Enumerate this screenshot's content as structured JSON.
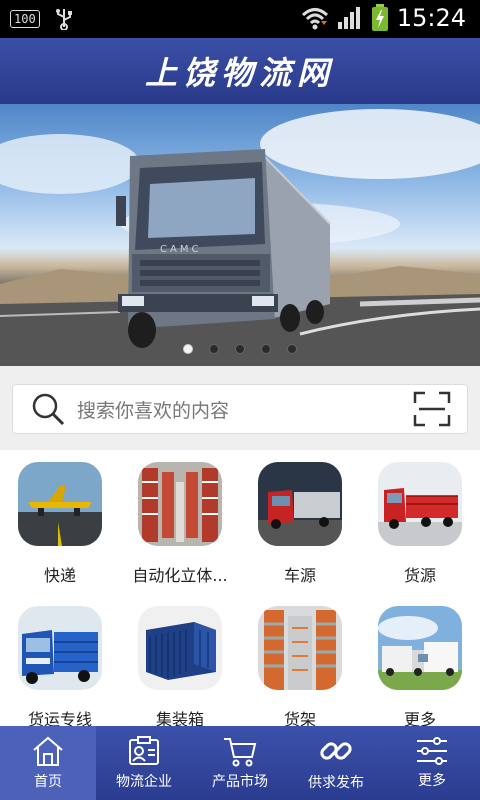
{
  "status_bar": {
    "battery_badge": "100",
    "time": "15:24"
  },
  "header": {
    "title": "上饶物流网"
  },
  "banner": {
    "slide_count": 5,
    "active_slide": 1,
    "truck_brand": "CAMC"
  },
  "search": {
    "placeholder": "搜索你喜欢的内容"
  },
  "grid": {
    "items": [
      {
        "label": "快递",
        "icon": "airplane-cargo"
      },
      {
        "label": "自动化立体...",
        "icon": "warehouse-racks"
      },
      {
        "label": "车源",
        "icon": "red-truck"
      },
      {
        "label": "货源",
        "icon": "cargo-truck"
      },
      {
        "label": "货运专线",
        "icon": "blue-truck"
      },
      {
        "label": "集装箱",
        "icon": "container"
      },
      {
        "label": "货架",
        "icon": "shelving"
      },
      {
        "label": "更多",
        "icon": "truck-fleet"
      }
    ]
  },
  "tabbar": {
    "items": [
      {
        "label": "首页",
        "icon": "home-icon",
        "active": true
      },
      {
        "label": "物流企业",
        "icon": "id-card-icon",
        "active": false
      },
      {
        "label": "产品市场",
        "icon": "cart-icon",
        "active": false
      },
      {
        "label": "供求发布",
        "icon": "link-icon",
        "active": false
      },
      {
        "label": "更多",
        "icon": "sliders-icon",
        "active": false
      }
    ]
  },
  "colors": {
    "header_blue": "#2f43a0",
    "tab_active": "#4c62b8"
  }
}
